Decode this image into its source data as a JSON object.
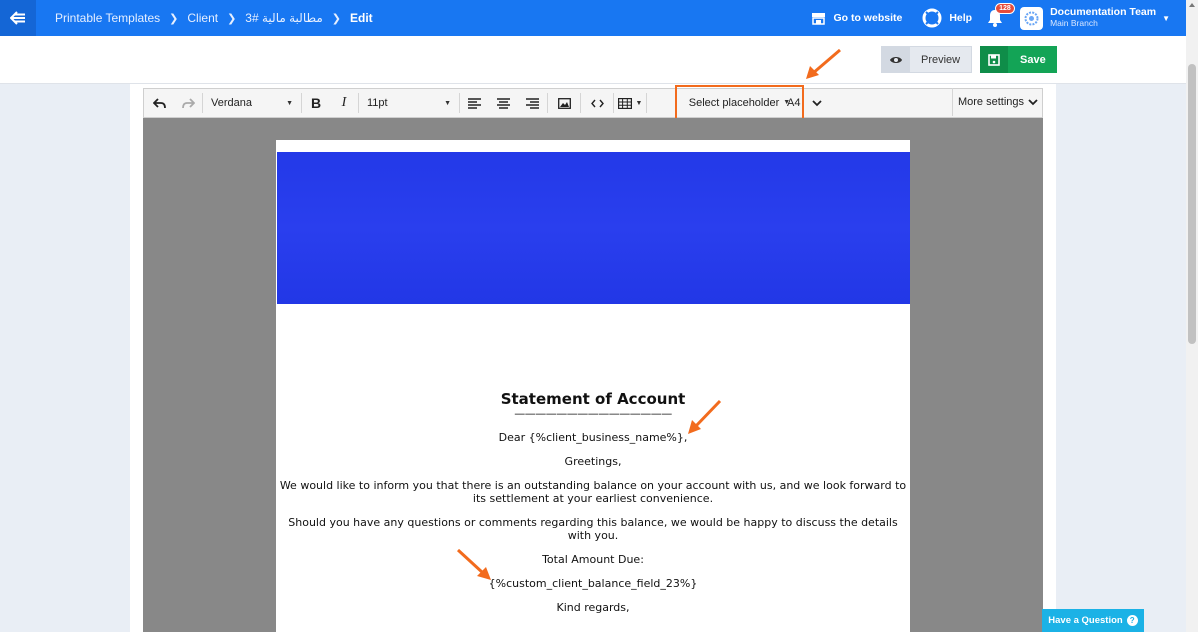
{
  "nav": {
    "breadcrumb": [
      "Printable Templates",
      "Client",
      "مطالبة مالية #3",
      "Edit"
    ],
    "go_to_website": "Go to website",
    "help": "Help",
    "notifications_count": "128",
    "account_name": "Documentation Team",
    "account_branch": "Main Branch"
  },
  "actions": {
    "preview": "Preview",
    "save": "Save"
  },
  "toolbar": {
    "font_family": "Verdana",
    "font_size": "11pt",
    "placeholder": "Select placeholder",
    "page_size": "A4",
    "more_settings": "More settings"
  },
  "document": {
    "title": "Statement of Account",
    "rule": "———————————————",
    "greeting": "Dear {%client_business_name%},",
    "salutation": "Greetings,",
    "paragraph1": "We would like to inform you that there is an outstanding balance on your account with us, and we look forward to its settlement at your earliest convenience.",
    "paragraph2": "Should you have any questions or comments regarding this balance, we would be happy to discuss the details with you.",
    "total_label": "Total Amount Due:",
    "total_value": "{%custom_client_balance_field_23%}",
    "closing": "Kind regards,"
  },
  "support": {
    "question": "Have a Question",
    "question_mark": "?"
  },
  "colors": {
    "nav": "#1877f2",
    "save": "#13a456",
    "highlight": "#f26b1d",
    "banner": "#2339e8"
  }
}
